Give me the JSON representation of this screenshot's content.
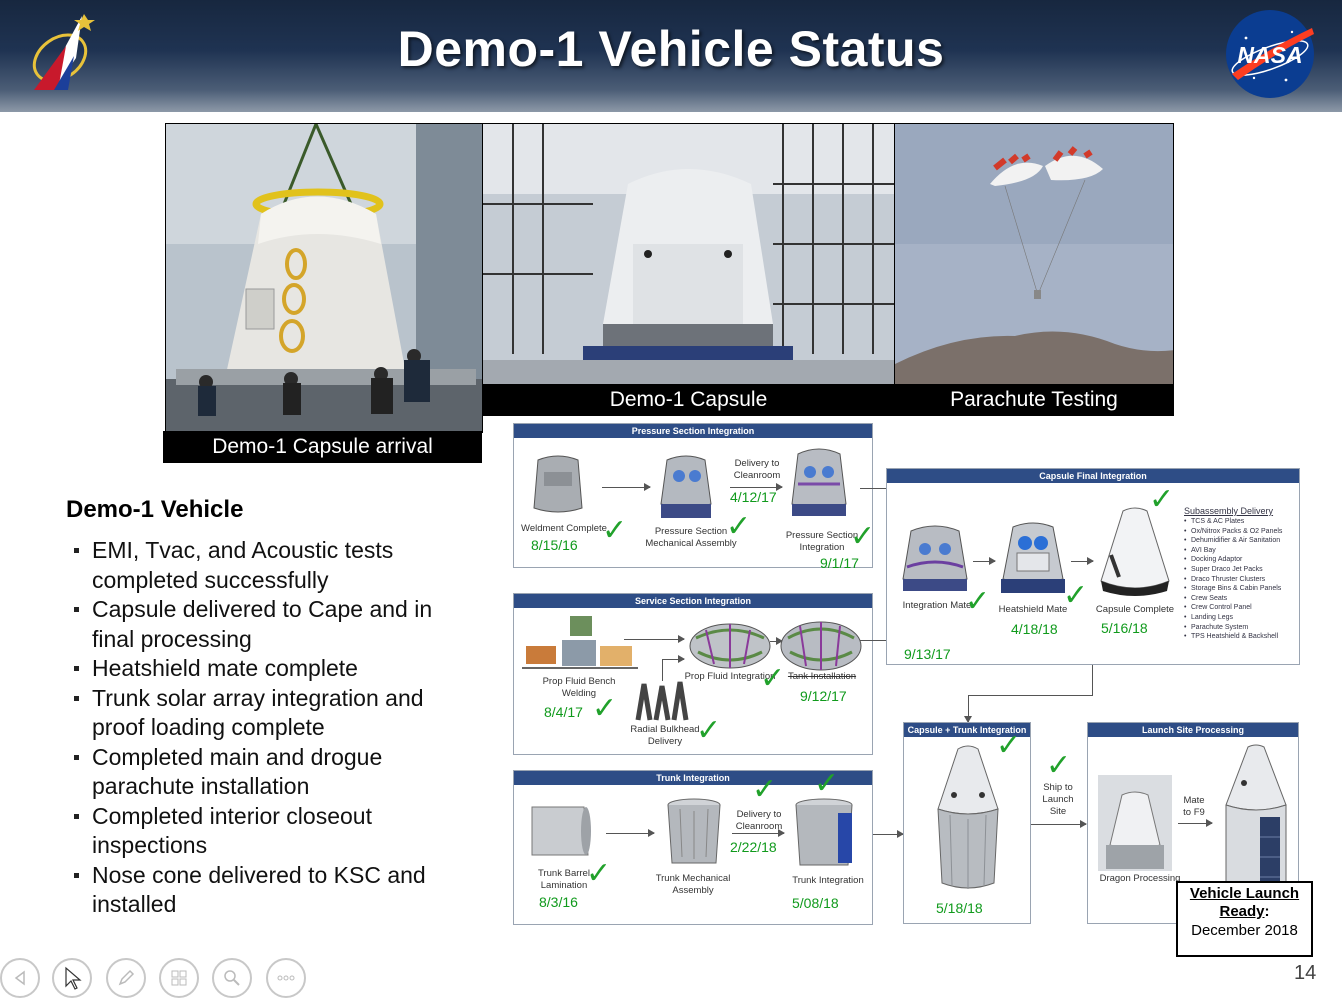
{
  "slide": {
    "title": "Demo-1 Vehicle Status",
    "page_number": "14"
  },
  "logos": {
    "left": "spacex-ccp-logo-icon",
    "right": "nasa-meatball-logo-icon",
    "nasa_text": "NASA"
  },
  "photos": [
    {
      "name": "capsule-arrival",
      "caption": "Demo-1 Capsule arrival"
    },
    {
      "name": "capsule",
      "caption": "Demo-1 Capsule"
    },
    {
      "name": "parachute-testing",
      "caption": "Parachute Testing"
    }
  ],
  "vehicle": {
    "heading": "Demo-1 Vehicle",
    "bullets": [
      "EMI, Tvac, and Acoustic tests completed successfully",
      "Capsule delivered to Cape and in final processing",
      "Heatshield mate complete",
      "Trunk solar array integration and proof loading complete",
      "Completed main and drogue parachute installation",
      "Completed interior closeout inspections",
      "Nose cone delivered to KSC and installed"
    ]
  },
  "flow": {
    "pressure": {
      "title": "Pressure Section Integration",
      "weldment": "Weldment Complete",
      "weldment_date": "8/15/16",
      "mech": "Pressure Section Mechanical Assembly",
      "delivery": "Delivery to Cleanroom",
      "delivery_date": "4/12/17",
      "integration": "Pressure Section Integration",
      "integration_date": "9/1/17"
    },
    "service": {
      "title": "Service Section Integration",
      "bench": "Prop Fluid Bench Welding",
      "bench_date": "8/4/17",
      "bulkhead": "Radial Bulkhead Delivery",
      "prop": "Prop Fluid Integration",
      "tank": "Tank Installation",
      "tank_date": "9/12/17"
    },
    "trunk": {
      "title": "Trunk Integration",
      "barrel": "Trunk Barrel Lamination",
      "barrel_date": "8/3/16",
      "mech": "Trunk Mechanical Assembly",
      "delivery": "Delivery to Cleanroom",
      "delivery_date": "2/22/18",
      "integration": "Trunk Integration",
      "integration_date": "5/08/18"
    },
    "final": {
      "title": "Capsule Final Integration",
      "mate": "Integration Mate",
      "mate_date": "9/13/17",
      "heatshield": "Heatshield Mate",
      "heatshield_date": "4/18/18",
      "complete": "Capsule Complete",
      "complete_date": "5/16/18",
      "subassembly_title": "Subassembly Delivery",
      "subassembly_items": [
        "TCS & AC Plates",
        "Ox/Nitrox Packs & O2 Panels",
        "Dehumidifier & Air Sanitation",
        "AVI Bay",
        "Docking Adaptor",
        "Super Draco Jet Packs",
        "Draco Thruster Clusters",
        "Storage Bins & Cabin Panels",
        "Crew Seats",
        "Crew Control Panel",
        "Landing Legs",
        "Parachute System",
        "TPS Heatshield & Backshell"
      ]
    },
    "capsule_trunk": {
      "title": "Capsule + Trunk Integration",
      "date": "5/18/18"
    },
    "ship": "Ship to Launch Site",
    "launch_site": {
      "title": "Launch Site Processing",
      "dragon": "Dragon Processing",
      "mate": "Mate to F9"
    },
    "ready": {
      "line1": "Vehicle Launch",
      "line2": "Ready",
      "line2_suffix": ":",
      "line3": "December 2018"
    }
  },
  "colors": {
    "header": "#1f3352",
    "panel_header": "#2e4d86",
    "check": "#21a12b",
    "date": "#109a1c"
  },
  "nav_icons": [
    "prev-icon",
    "pointer-icon",
    "pen-icon",
    "slides-icon",
    "zoom-icon",
    "more-icon"
  ]
}
